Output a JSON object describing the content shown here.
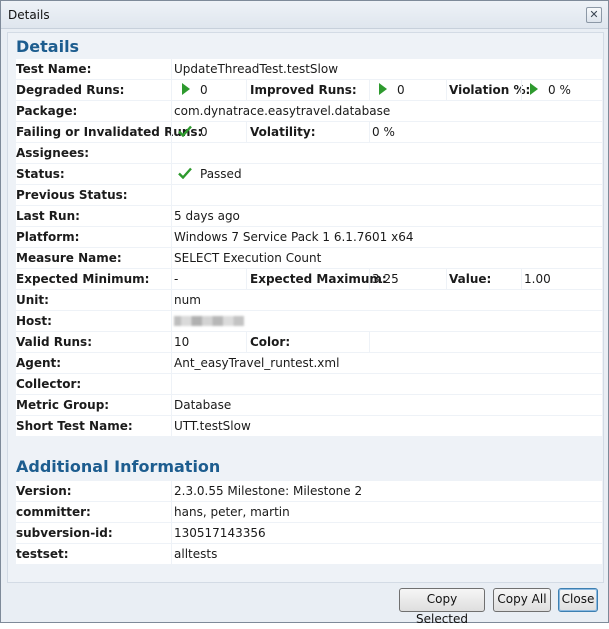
{
  "window": {
    "title": "Details",
    "close_glyph": "✕"
  },
  "details": {
    "heading": "Details",
    "test_name": {
      "label": "Test Name:",
      "value": "UpdateThreadTest.testSlow"
    },
    "degraded_runs": {
      "label": "Degraded Runs:",
      "value": "0"
    },
    "improved_runs": {
      "label": "Improved Runs:",
      "value": "0"
    },
    "violation_pct": {
      "label": "Violation %:",
      "value": "0 %"
    },
    "package": {
      "label": "Package:",
      "value": "com.dynatrace.easytravel.database"
    },
    "failing_runs": {
      "label": "Failing or Invalidated Runs:",
      "value": "0"
    },
    "volatility": {
      "label": "Volatility:",
      "value": "0 %"
    },
    "assignees": {
      "label": "Assignees:",
      "value": ""
    },
    "status": {
      "label": "Status:",
      "value": "Passed"
    },
    "previous_status": {
      "label": "Previous Status:",
      "value": ""
    },
    "last_run": {
      "label": "Last Run:",
      "value": "5 days ago"
    },
    "platform": {
      "label": "Platform:",
      "value": "Windows 7 Service Pack 1 6.1.7601 x64"
    },
    "measure_name": {
      "label": "Measure Name:",
      "value": "SELECT Execution Count"
    },
    "expected_minimum": {
      "label": "Expected Minimum:",
      "value": "-"
    },
    "expected_maximum": {
      "label": "Expected Maximum:",
      "value": "3.25"
    },
    "value": {
      "label": "Value:",
      "value": "1.00"
    },
    "unit": {
      "label": "Unit:",
      "value": "num"
    },
    "host": {
      "label": "Host:",
      "value": ""
    },
    "valid_runs": {
      "label": "Valid Runs:",
      "value": "10"
    },
    "color": {
      "label": "Color:",
      "value": ""
    },
    "agent": {
      "label": "Agent:",
      "value": "Ant_easyTravel_runtest.xml"
    },
    "collector": {
      "label": "Collector:",
      "value": ""
    },
    "metric_group": {
      "label": "Metric Group:",
      "value": "Database"
    },
    "short_test_name": {
      "label": "Short Test Name:",
      "value": "UTT.testSlow"
    }
  },
  "additional": {
    "heading": "Additional Information",
    "version": {
      "label": "Version:",
      "value": "2.3.0.55 Milestone: Milestone 2"
    },
    "committer": {
      "label": "committer:",
      "value": "hans, peter, martin"
    },
    "subversion_id": {
      "label": "subversion-id:",
      "value": "130517143356"
    },
    "testset": {
      "label": "testset:",
      "value": "alltests"
    }
  },
  "buttons": {
    "copy_selected": "Copy Selected",
    "copy_all": "Copy All",
    "close": "Close"
  },
  "colors": {
    "heading": "#1d5d8f",
    "trend_arrow": "#2e9a2e",
    "check": "#2e9a2e"
  }
}
